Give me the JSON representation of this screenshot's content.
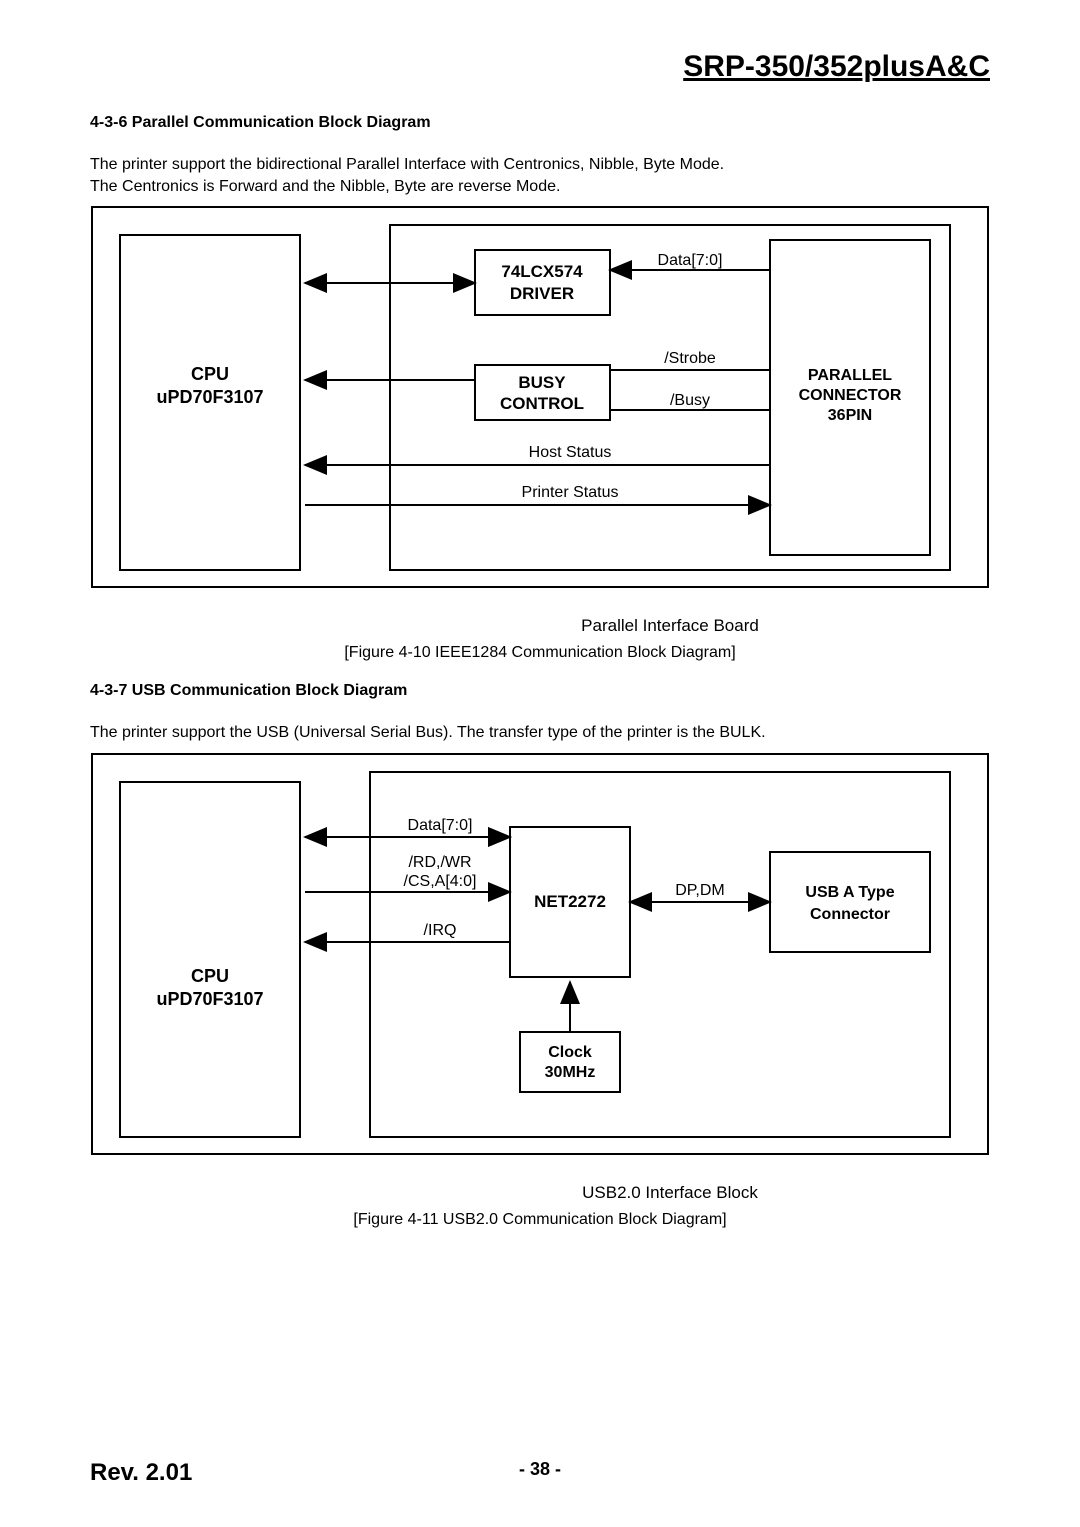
{
  "header": {
    "title": "SRP-350/352plusA&C"
  },
  "sec1": {
    "title": "4-3-6 Parallel Communication Block Diagram",
    "p1": "The printer support the bidirectional Parallel Interface with Centronics, Nibble, Byte Mode.",
    "p2": "The Centronics is Forward and the Nibble, Byte are reverse Mode."
  },
  "diagram1": {
    "cpu_l1": "CPU",
    "cpu_l2": "uPD70F3107",
    "driver_l1": "74LCX574",
    "driver_l2": "DRIVER",
    "data": "Data[7:0]",
    "strobe": "/Strobe",
    "busy_l1": "BUSY",
    "busy_l2": "CONTROL",
    "busy_out": "/Busy",
    "hoststatus": "Host Status",
    "printerstatus": "Printer Status",
    "conn_l1": "PARALLEL",
    "conn_l2": "CONNECTOR",
    "conn_l3": "36PIN",
    "sub": "Parallel Interface Board"
  },
  "fig1_caption": "[Figure 4-10 IEEE1284 Communication Block Diagram]",
  "sec2": {
    "title": "4-3-7 USB Communication Block Diagram",
    "p1": "The printer support the USB (Universal Serial Bus). The transfer type of the printer is the BULK."
  },
  "diagram2": {
    "cpu_l1": "CPU",
    "cpu_l2": "uPD70F3107",
    "data": "Data[7:0]",
    "rdwr": "/RD,/WR",
    "csa": "/CS,A[4:0]",
    "irq": "/IRQ",
    "net": "NET2272",
    "dpdm": "DP,DM",
    "usb_l1": "USB A Type",
    "usb_l2": "Connector",
    "clk_l1": "Clock",
    "clk_l2": "30MHz",
    "sub": "USB2.0 Interface Block"
  },
  "fig2_caption": "[Figure 4-11 USB2.0 Communication Block Diagram]",
  "footer": {
    "rev": "Rev. 2.01",
    "page": "- 38 -"
  }
}
